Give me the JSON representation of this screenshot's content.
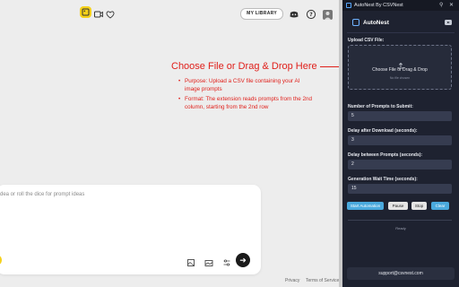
{
  "main": {
    "library_button": "MY LIBRARY",
    "annotation": {
      "title": "Choose File or Drag & Drop Here",
      "bullets": [
        "Purpose: Upload a CSV file containing your AI image prompts",
        "Format: The extension reads prompts from the 2nd column, starting from the 2nd row"
      ]
    },
    "prompt_placeholder": "dea or roll the dice for prompt ideas",
    "footer": {
      "privacy": "Privacy",
      "terms": "Terms of Service"
    }
  },
  "panel": {
    "window_title": "AutoNest By CSVNest",
    "app_name": "AutoNest",
    "upload_label": "Upload CSV File:",
    "dropzone_text": "Choose File or Drag & Drop",
    "dropzone_subtext": "No file chosen",
    "fields": [
      {
        "label": "Number of Prompts to Submit:",
        "value": "5"
      },
      {
        "label": "Delay after Download (seconds):",
        "value": "3"
      },
      {
        "label": "Delay between Prompts (seconds):",
        "value": "2"
      },
      {
        "label": "Generation Wait Time (seconds):",
        "value": "15"
      }
    ],
    "buttons": {
      "start": "Start Automation",
      "pause": "Pause",
      "stop": "Stop",
      "clear": "Clear"
    },
    "status": "Ready",
    "support_email": "support@csvnest.com"
  },
  "colors": {
    "annotation_red": "#e0201b",
    "accent_yellow": "#f5d11a",
    "panel_bg": "#1e2230",
    "button_blue": "#4aa9dd"
  },
  "icons": [
    "image-icon",
    "video-icon",
    "heart-icon",
    "discord-icon",
    "help-icon",
    "avatar",
    "pin-icon",
    "close-icon",
    "youtube-icon",
    "upload-icon",
    "dice-icon",
    "send-icon"
  ]
}
